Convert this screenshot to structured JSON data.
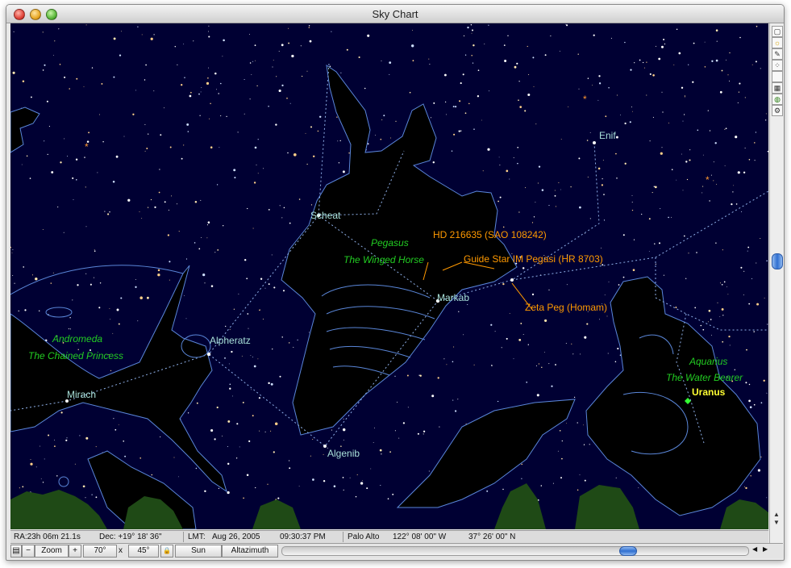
{
  "window": {
    "title": "Sky Chart"
  },
  "labels": {
    "stars": {
      "scheat": "Scheat",
      "markab": "Markab",
      "alpheratz": "Alpheratz",
      "mirach": "Mirach",
      "algenib": "Algenib",
      "enif": "Enif"
    },
    "constellations": {
      "pegasus": "Pegasus",
      "pegasus_sub": "The Winged Horse",
      "andromeda": "Andromeda",
      "andromeda_sub": "The Chained Princess",
      "aquarius": "Aquarius",
      "aquarius_sub": "The Water Bearer"
    },
    "objects": {
      "hd": "HD 216635 (SAO 108242)",
      "guide": "Guide Star IM Pegasi (HR  8703)",
      "zeta": "Zeta Peg  (Homam)"
    },
    "planets": {
      "uranus": "Uranus"
    }
  },
  "status": {
    "ra": "RA:23h 06m 21.1s",
    "dec": "Dec: +19° 18' 36\"",
    "lmt_label": "LMT:",
    "date": "Aug 26, 2005",
    "time": "09:30:37 PM",
    "location": "Palo Alto",
    "longitude": "122° 08' 00\" W",
    "latitude": "37° 26' 00\" N"
  },
  "controls": {
    "zoom_label": "Zoom",
    "zoom_out": "−",
    "zoom_in": "+",
    "fov_width": "70°",
    "fov_x": "x",
    "fov_height": "45°",
    "lock": "🔒",
    "center_object": "Sun",
    "projection": "Altazimuth"
  },
  "toolbar_icons": [
    "window-icon",
    "sun-icon",
    "pencil-icon",
    "scatter-icon",
    "blank-icon",
    "grid-icon",
    "globe-icon",
    "tools-icon"
  ],
  "colors": {
    "sky": "#000033",
    "star_label": "#a8e0d8",
    "constellation_label": "#22cc22",
    "object_label": "#ff9900",
    "planet_label": "#ffff33",
    "constellation_lines": "#6a9fff"
  }
}
